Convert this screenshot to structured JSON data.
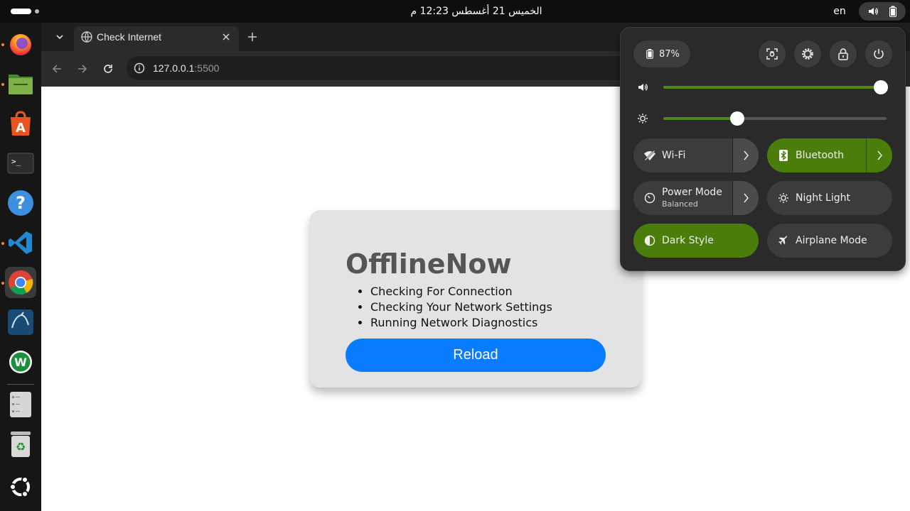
{
  "topbar": {
    "clock": "الخميس 21 أغسطس  12:23 م",
    "language": "en"
  },
  "dock": {
    "items": [
      {
        "name": "firefox-icon",
        "running": true
      },
      {
        "name": "files-icon",
        "running": true
      },
      {
        "name": "app-center-icon",
        "running": false
      },
      {
        "name": "terminal-icon",
        "running": false
      },
      {
        "name": "help-icon",
        "running": false
      },
      {
        "name": "vscode-icon",
        "running": true
      },
      {
        "name": "chrome-icon",
        "running": true
      },
      {
        "name": "mysql-workbench-icon",
        "running": false
      },
      {
        "name": "whatsapp-icon",
        "running": false
      },
      {
        "name": "file-manager-icon",
        "running": false
      },
      {
        "name": "trash-icon",
        "running": false
      },
      {
        "name": "ubuntu-apps-icon",
        "running": false
      }
    ]
  },
  "browser": {
    "tab_title": "Check Internet",
    "url_host": "127.0.0.1",
    "url_port": ":5500"
  },
  "page": {
    "title": "OfflineNow",
    "items": [
      "Checking For Connection",
      "Checking Your Network Settings",
      "Running Network Diagnostics"
    ],
    "reload_label": "Reload",
    "accent": "#0a7cff"
  },
  "quick_settings": {
    "battery_percent": "87%",
    "volume_level": 0.975,
    "brightness_level": 0.33,
    "accent": "#4b7d0b",
    "toggles": {
      "wifi": {
        "label": "Wi-Fi",
        "on": false
      },
      "bluetooth": {
        "label": "Bluetooth",
        "on": true
      },
      "power_mode": {
        "label": "Power Mode",
        "sub": "Balanced",
        "on": false
      },
      "night_light": {
        "label": "Night Light",
        "on": false
      },
      "dark_style": {
        "label": "Dark Style",
        "on": true
      },
      "airplane_mode": {
        "label": "Airplane Mode",
        "on": false
      }
    }
  }
}
